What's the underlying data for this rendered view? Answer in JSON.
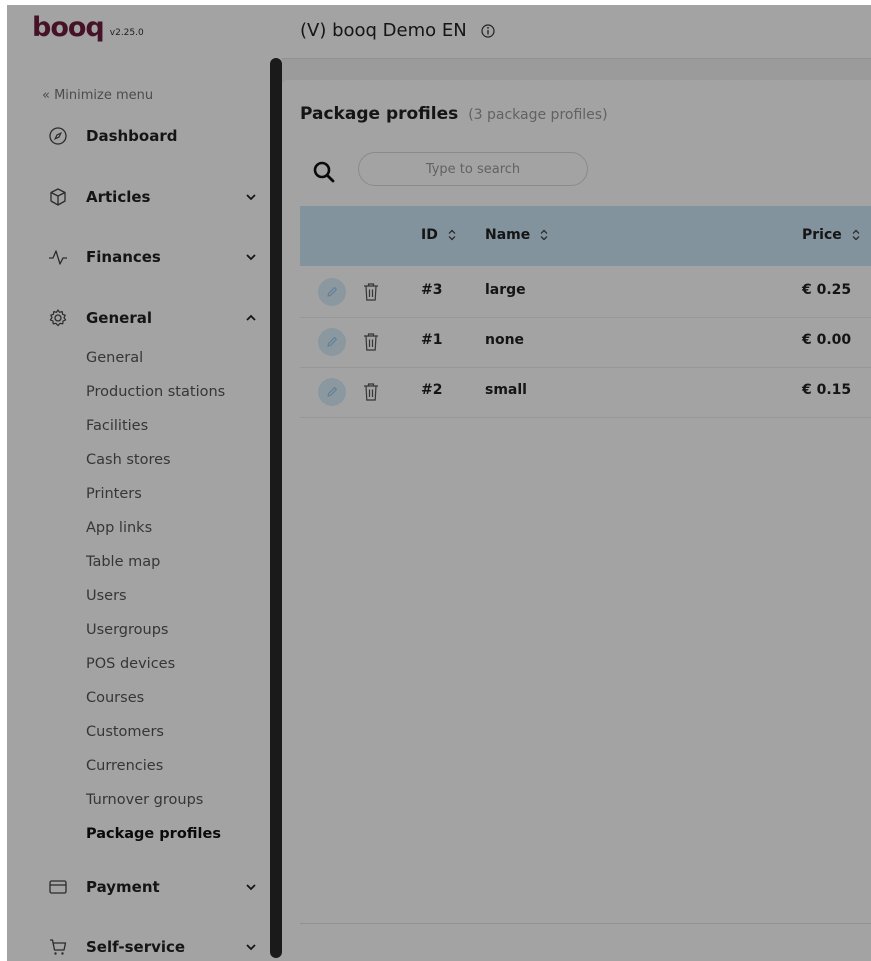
{
  "header": {
    "logo_text": "booq",
    "version": "v2.25.0",
    "title": "(V) booq Demo EN",
    "info_icon": "info-circle-icon"
  },
  "sidebar": {
    "minimize_label": "« Minimize menu",
    "groups": [
      {
        "label": "Dashboard",
        "icon": "compass-icon"
      },
      {
        "label": "Articles",
        "icon": "box-icon",
        "chevron": "chevron-down-icon"
      },
      {
        "label": "Finances",
        "icon": "pulse-icon",
        "chevron": "chevron-down-icon"
      },
      {
        "label": "General",
        "icon": "gear-icon",
        "chevron": "chevron-up-icon"
      },
      {
        "label": "Payment",
        "icon": "card-icon",
        "chevron": "chevron-down-icon"
      },
      {
        "label": "Self-service",
        "icon": "cart-icon",
        "chevron": "chevron-down-icon"
      }
    ],
    "general_items": [
      "General",
      "Production stations",
      "Facilities",
      "Cash stores",
      "Printers",
      "App links",
      "Table map",
      "Users",
      "Usergroups",
      "POS devices",
      "Courses",
      "Customers",
      "Currencies",
      "Turnover groups",
      "Package profiles"
    ],
    "active_item": "Package profiles"
  },
  "main": {
    "title": "Package profiles",
    "count": "(3 package profiles)",
    "search": {
      "placeholder": "Type to search",
      "value": ""
    },
    "table": {
      "columns": [
        "ID",
        "Name",
        "Price"
      ],
      "rows": [
        {
          "id": "#3",
          "name": "large",
          "price": "€ 0.25"
        },
        {
          "id": "#1",
          "name": "none",
          "price": "€ 0.00"
        },
        {
          "id": "#2",
          "name": "small",
          "price": "€ 0.15"
        }
      ]
    }
  },
  "colors": {
    "brand": "#6d1d3e",
    "table_header": "#cbe6f8",
    "edit_button_bg": "#dbeefa",
    "overlay": "rgba(0,0,0,0.36)"
  }
}
